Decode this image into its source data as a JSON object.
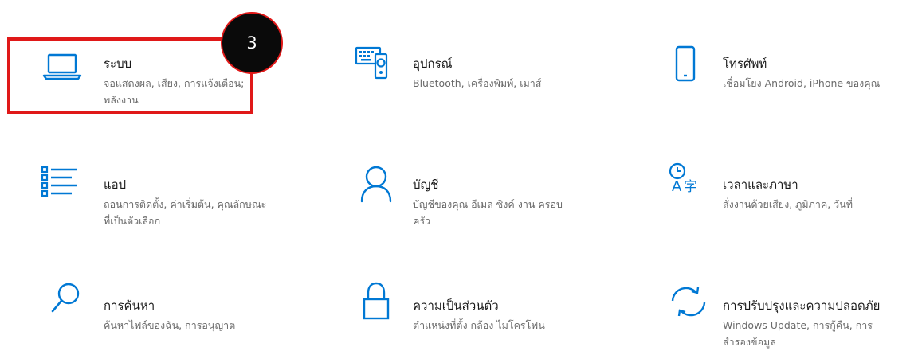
{
  "step_badge": "3",
  "colors": {
    "accent": "#0078d4",
    "highlight": "#e01818"
  },
  "tiles": [
    {
      "title": "ระบบ",
      "desc": [
        "จอแสดงผล, เสียง, การแจ้งเตือน;",
        "พลังงาน"
      ],
      "icon": "laptop-icon"
    },
    {
      "title": "อุปกรณ์",
      "desc": [
        "Bluetooth, เครื่องพิมพ์, เมาส์"
      ],
      "icon": "devices-icon"
    },
    {
      "title": "โทรศัพท์",
      "desc": [
        "เชื่อมโยง Android, iPhone ของคุณ"
      ],
      "icon": "phone-icon"
    },
    {
      "title": "แอป",
      "desc": [
        "ถอนการติดตั้ง, ค่าเริ่มต้น, คุณลักษณะ",
        "ที่เป็นตัวเลือก"
      ],
      "icon": "apps-list-icon"
    },
    {
      "title": "บัญชี",
      "desc": [
        "บัญชีของคุณ อีเมล ซิงค์ งาน ครอบ",
        "ครัว"
      ],
      "icon": "person-icon"
    },
    {
      "title": "เวลาและภาษา",
      "desc": [
        "สั่งงานด้วยเสียง, ภูมิภาค, วันที่"
      ],
      "icon": "time-language-icon"
    },
    {
      "title": "การค้นหา",
      "desc": [
        "ค้นหาไฟล์ของฉัน, การอนุญาต"
      ],
      "icon": "search-icon"
    },
    {
      "title": "ความเป็นส่วนตัว",
      "desc": [
        "ตำแหน่งที่ตั้ง กล้อง ไมโครโฟน"
      ],
      "icon": "lock-icon"
    },
    {
      "title": "การปรับปรุงและความปลอดภัย",
      "desc": [
        "Windows Update, การกู้คืน, การ",
        "สำรองข้อมูล"
      ],
      "icon": "sync-icon"
    }
  ]
}
